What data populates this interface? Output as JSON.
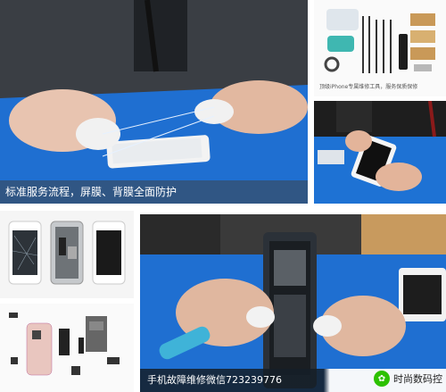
{
  "panels": {
    "top_left": {
      "caption": "标准服务流程，屏膜、背膜全面防护"
    },
    "top_right_upper": {
      "caption": "顶级iPhone专属维修工具，服务保质保修"
    },
    "bottom_banner": {
      "text": "手机故障维修微信723239776",
      "account_name": "时尚数码控"
    }
  },
  "colors": {
    "mat_blue": "#1f6fd1",
    "caption_bg": "#1e2a36",
    "wechat_green": "#2dc100"
  }
}
